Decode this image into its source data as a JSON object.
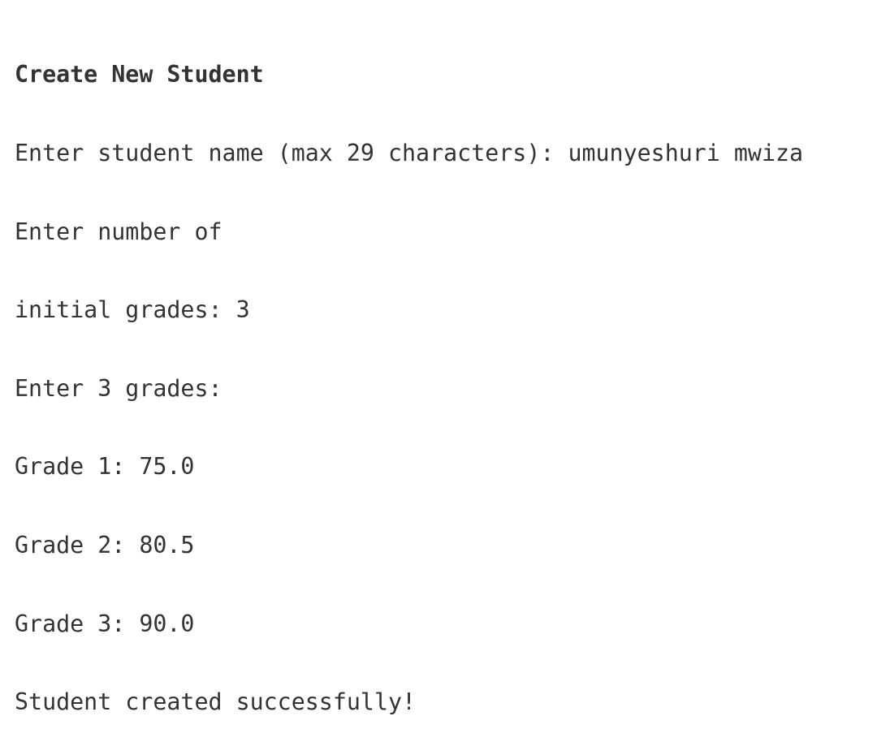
{
  "screen": {
    "title": "Create New Student",
    "lines": [
      "Enter student name (max 29 characters): umunyeshuri mwiza",
      "Enter number of",
      "initial grades: 3",
      "Enter 3 grades:",
      "Grade 1: 75.0",
      "Grade 2: 80.5",
      "Grade 3: 90.0",
      "Student created successfully!"
    ]
  },
  "colors": {
    "text": "#333333",
    "background": "#ffffff"
  }
}
